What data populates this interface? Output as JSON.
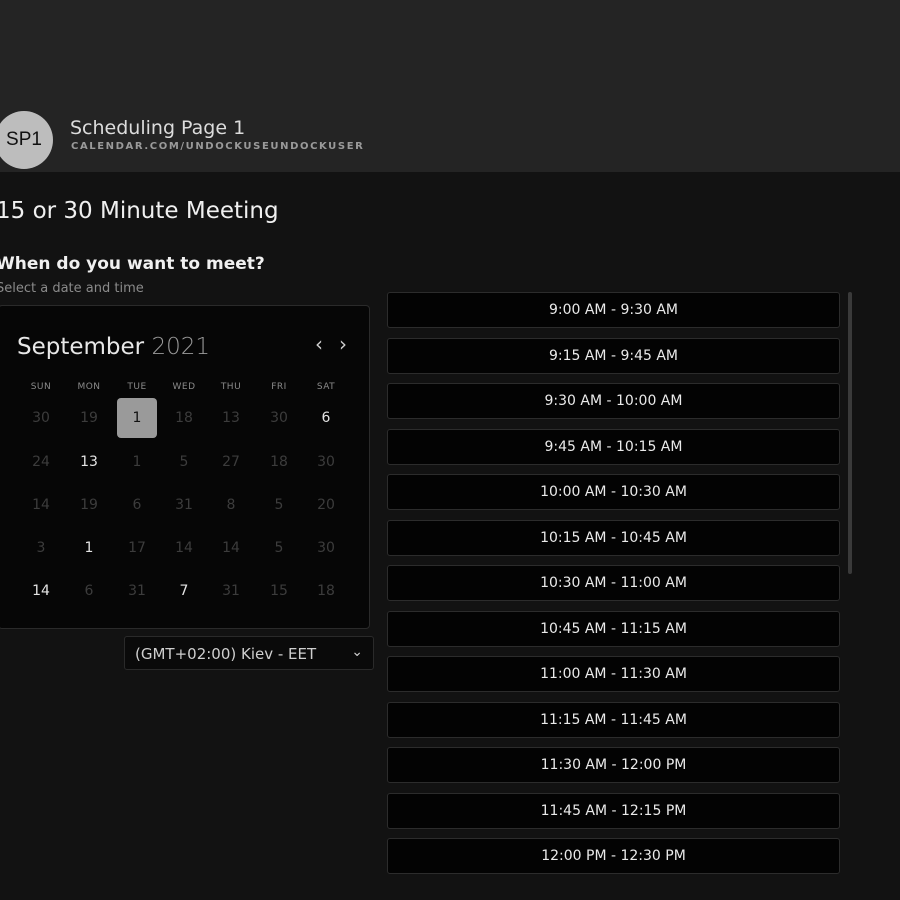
{
  "header": {
    "avatar_initials": "SP1",
    "page_name": "Scheduling Page 1",
    "page_url": "CALENDAR.COM/UNDOCKUSEUNDOCKUSER"
  },
  "meeting": {
    "title": "15 or 30 Minute Meeting",
    "question": "When do you want to meet?",
    "subtext": "Select a date and time"
  },
  "calendar": {
    "month": "September",
    "year": "2021",
    "prev_icon": "chevron-left-icon",
    "next_icon": "chevron-right-icon",
    "weekdays": [
      "SUN",
      "MON",
      "TUE",
      "WED",
      "THU",
      "FRI",
      "SAT"
    ],
    "weeks": [
      [
        {
          "d": "30",
          "a": false
        },
        {
          "d": "19",
          "a": false
        },
        {
          "d": "1",
          "a": true,
          "sel": true
        },
        {
          "d": "18",
          "a": false
        },
        {
          "d": "13",
          "a": false
        },
        {
          "d": "30",
          "a": false
        },
        {
          "d": "6",
          "a": true
        }
      ],
      [
        {
          "d": "24",
          "a": false
        },
        {
          "d": "13",
          "a": true
        },
        {
          "d": "1",
          "a": false
        },
        {
          "d": "5",
          "a": false
        },
        {
          "d": "27",
          "a": false
        },
        {
          "d": "18",
          "a": false
        },
        {
          "d": "30",
          "a": false
        }
      ],
      [
        {
          "d": "14",
          "a": false
        },
        {
          "d": "19",
          "a": false
        },
        {
          "d": "6",
          "a": false
        },
        {
          "d": "31",
          "a": false
        },
        {
          "d": "8",
          "a": false
        },
        {
          "d": "5",
          "a": false
        },
        {
          "d": "20",
          "a": false
        }
      ],
      [
        {
          "d": "3",
          "a": false
        },
        {
          "d": "1",
          "a": true
        },
        {
          "d": "17",
          "a": false
        },
        {
          "d": "14",
          "a": false
        },
        {
          "d": "14",
          "a": false
        },
        {
          "d": "5",
          "a": false
        },
        {
          "d": "30",
          "a": false
        }
      ],
      [
        {
          "d": "14",
          "a": true
        },
        {
          "d": "6",
          "a": false
        },
        {
          "d": "31",
          "a": false
        },
        {
          "d": "7",
          "a": true
        },
        {
          "d": "31",
          "a": false
        },
        {
          "d": "15",
          "a": false
        },
        {
          "d": "18",
          "a": false
        }
      ]
    ]
  },
  "timezone": {
    "label": "(GMT+02:00) Kiev - EET",
    "icon": "chevron-down-icon"
  },
  "slots": [
    "9:00 AM - 9:30 AM",
    "9:15 AM - 9:45 AM",
    "9:30 AM - 10:00 AM",
    "9:45 AM - 10:15 AM",
    "10:00 AM - 10:30 AM",
    "10:15 AM - 10:45 AM",
    "10:30 AM - 11:00 AM",
    "10:45 AM - 11:15 AM",
    "11:00 AM - 11:30 AM",
    "11:15 AM - 11:45 AM",
    "11:30 AM - 12:00 PM",
    "11:45 AM - 12:15 PM",
    "12:00 PM - 12:30 PM"
  ]
}
